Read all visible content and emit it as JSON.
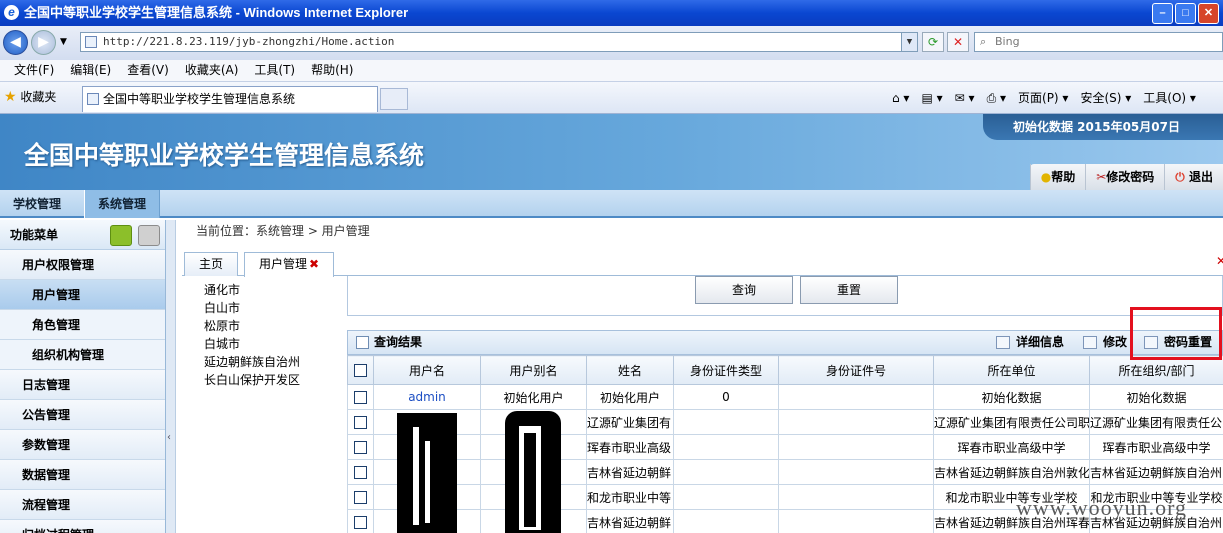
{
  "window": {
    "title": "全国中等职业学校学生管理信息系统 - Windows Internet Explorer",
    "address": "http://221.8.23.119/jyb-zhongzhi/Home.action",
    "search_placeholder": "Bing"
  },
  "browser_menu": [
    "文件(F)",
    "编辑(E)",
    "查看(V)",
    "收藏夹(A)",
    "工具(T)",
    "帮助(H)"
  ],
  "favorites": {
    "label": "收藏夹",
    "tab_title": "全国中等职业学校学生管理信息系统",
    "commands": [
      "页面(P) ▾",
      "安全(S) ▾",
      "工具(O) ▾"
    ]
  },
  "app": {
    "title": "全国中等职业学校学生管理信息系统",
    "init_date": "初始化数据 2015年05月07日",
    "header_buttons": [
      "帮助",
      "修改密码",
      "退出"
    ],
    "nav_tabs": [
      "学校管理",
      "系统管理"
    ]
  },
  "sidebar": {
    "title": "功能菜单",
    "items": [
      {
        "label": "用户权限管理"
      },
      {
        "label": "用户管理"
      },
      {
        "label": "角色管理"
      },
      {
        "label": "组织机构管理"
      },
      {
        "label": "日志管理"
      },
      {
        "label": "公告管理"
      },
      {
        "label": "参数管理"
      },
      {
        "label": "数据管理"
      },
      {
        "label": "流程管理"
      },
      {
        "label": "归档过程管理"
      }
    ]
  },
  "main": {
    "breadcrumb": "当前位置：系统管理 > 用户管理",
    "tabs": [
      "主页",
      "用户管理"
    ],
    "cities": [
      "通化市",
      "白山市",
      "松原市",
      "白城市",
      "延边朝鲜族自治州",
      "长白山保护开发区"
    ],
    "query_button": "查询",
    "reset_button": "重置",
    "results_title": "查询结果",
    "toolbar": [
      "详细信息",
      "修改",
      "密码重置"
    ],
    "columns": [
      "用户名",
      "用户别名",
      "姓名",
      "身份证件类型",
      "身份证件号",
      "所在单位",
      "所在组织/部门"
    ],
    "rows": [
      {
        "username": "admin",
        "alias": "初始化用户",
        "name": "初始化用户",
        "idtype": "0",
        "idnum": "",
        "unit": "初始化数据",
        "dept": "初始化数据"
      },
      {
        "username": "",
        "alias": "",
        "name": "辽源矿业集团有",
        "idtype": "",
        "idnum": "",
        "unit": "辽源矿业集团有限责任公司职",
        "dept": "辽源矿业集团有限责任公"
      },
      {
        "username": "",
        "alias": "",
        "name": "珲春市职业高级",
        "idtype": "",
        "idnum": "",
        "unit": "珲春市职业高级中学",
        "dept": "珲春市职业高级中学"
      },
      {
        "username": "",
        "alias": "",
        "name": "吉林省延边朝鲜",
        "idtype": "",
        "idnum": "",
        "unit": "吉林省延边朝鲜族自治州敦化",
        "dept": "吉林省延边朝鲜族自治州"
      },
      {
        "username": "",
        "alias": "",
        "name": "和龙市职业中等",
        "idtype": "",
        "idnum": "",
        "unit": "和龙市职业中等专业学校",
        "dept": "和龙市职业中等专业学校"
      },
      {
        "username": "",
        "alias": "",
        "name": "吉林省延边朝鲜",
        "idtype": "",
        "idnum": "",
        "unit": "吉林省延边朝鲜族自治州珲春",
        "dept": "吉林省延边朝鲜族自治州"
      }
    ]
  },
  "watermark": "www.wooyun.org"
}
